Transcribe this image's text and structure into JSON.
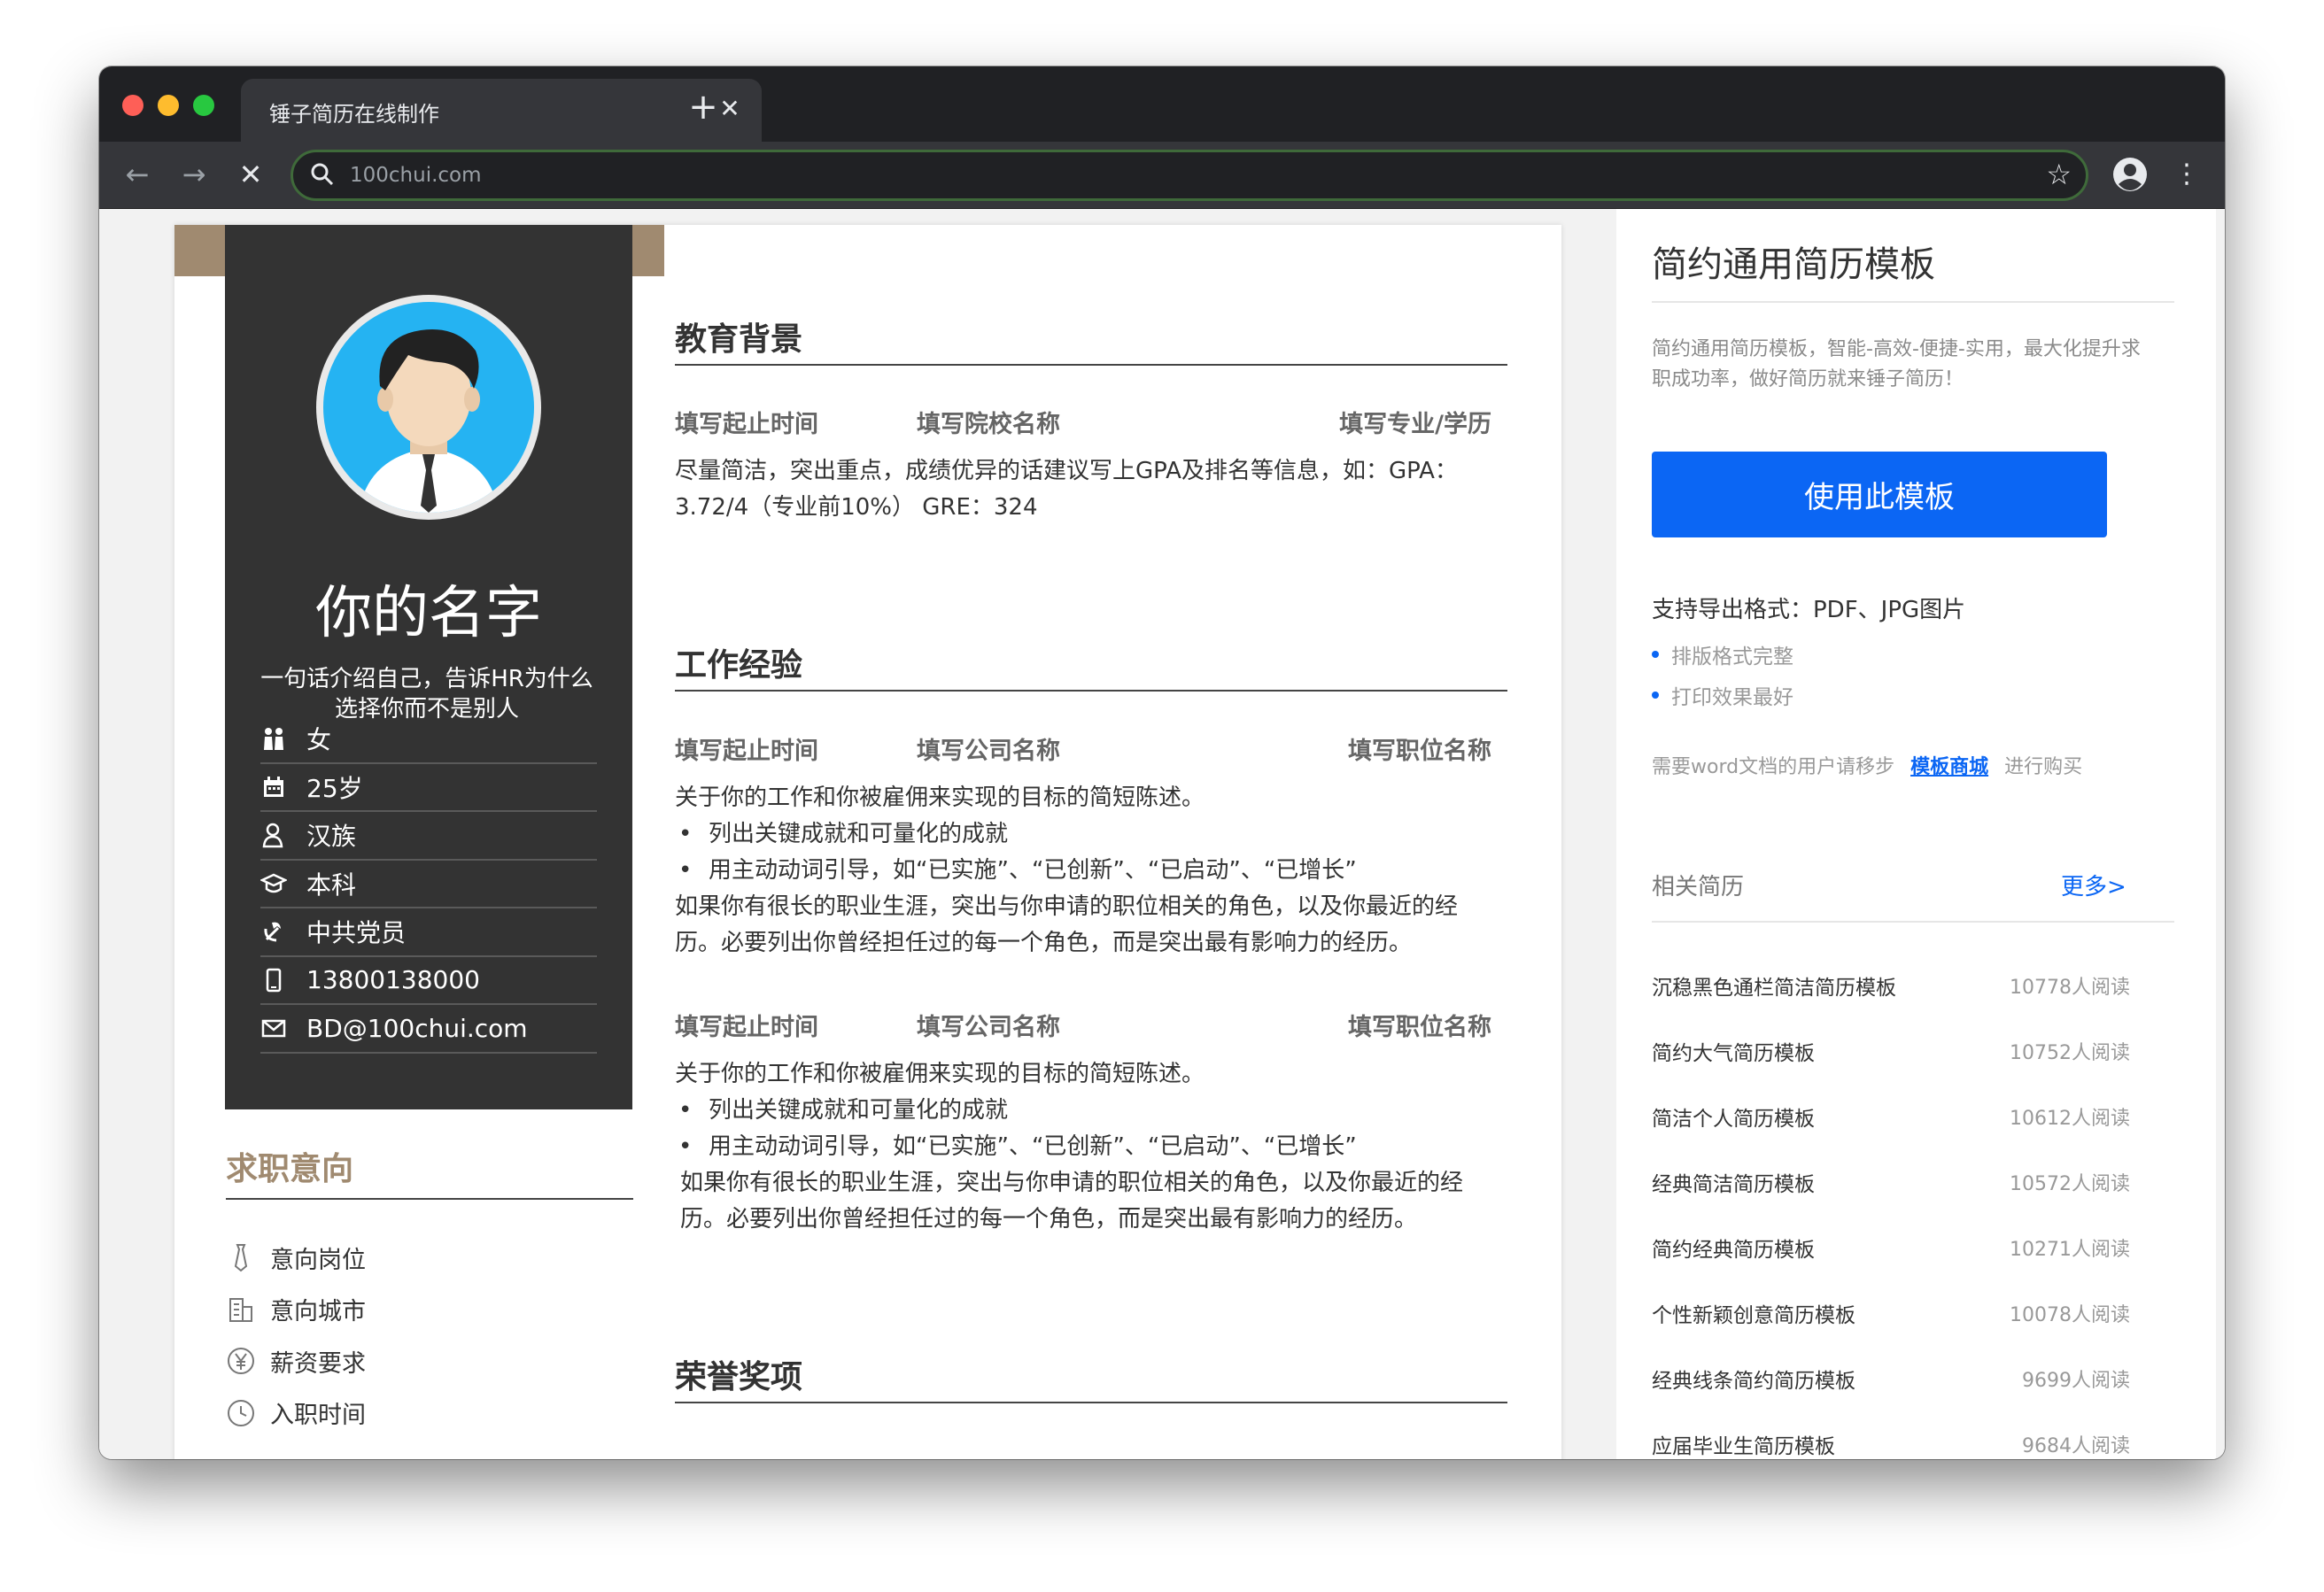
{
  "browser": {
    "tab_title": "锤子简历在线制作",
    "url": "100chui.com",
    "accent_color": "#3f6a3a"
  },
  "resume": {
    "name": "你的名字",
    "intro": "一句话介绍自己，告诉HR为什么选择你而不是别人",
    "info": [
      {
        "icon": "gender-icon",
        "text": "女"
      },
      {
        "icon": "calendar-icon",
        "text": "25岁"
      },
      {
        "icon": "person-icon",
        "text": "汉族"
      },
      {
        "icon": "graduation-cap-icon",
        "text": "本科"
      },
      {
        "icon": "party-icon",
        "text": "中共党员"
      },
      {
        "icon": "phone-icon",
        "text": "13800138000"
      },
      {
        "icon": "mail-icon",
        "text": "BD@100chui.com"
      }
    ],
    "intent": {
      "title": "求职意向",
      "items": [
        {
          "icon": "tie-icon",
          "text": "意向岗位"
        },
        {
          "icon": "building-icon",
          "text": "意向城市"
        },
        {
          "icon": "yen-icon",
          "text": "薪资要求"
        },
        {
          "icon": "clock-icon",
          "text": "入职时间"
        }
      ]
    },
    "education": {
      "title": "教育背景",
      "row": [
        "填写起止时间",
        "填写院校名称",
        "填写专业/学历"
      ],
      "desc": "尽量简洁，突出重点，成绩优异的话建议写上GPA及排名等信息，如：GPA：3.72/4（专业前10%） GRE：324"
    },
    "work": {
      "title": "工作经验",
      "entries": [
        {
          "row": [
            "填写起止时间",
            "填写公司名称",
            "填写职位名称"
          ],
          "lines": [
            "关于你的工作和你被雇佣来实现的目标的简短陈述。",
            "列出关键成就和可量化的成就",
            "用主动动词引导，如“已实施”、“已创新”、“已启动”、“已增长”",
            "如果你有很长的职业生涯，突出与你申请的职位相关的角色，以及你最近的经历。必要列出你曾经担任过的每一个角色，而是突出最有影响力的经历。"
          ]
        },
        {
          "row": [
            "填写起止时间",
            "填写公司名称",
            "填写职位名称"
          ],
          "lines": [
            "关于你的工作和你被雇佣来实现的目标的简短陈述。",
            "列出关键成就和可量化的成就",
            "用主动动词引导，如“已实施”、“已创新”、“已启动”、“已增长”",
            "如果你有很长的职业生涯，突出与你申请的职位相关的角色，以及你最近的经历。必要列出你曾经担任过的每一个角色，而是突出最有影响力的经历。"
          ]
        }
      ]
    },
    "honors": {
      "title": "荣誉奖项"
    }
  },
  "panel": {
    "title": "简约通用简历模板",
    "desc": "简约通用简历模板，智能-高效-便捷-实用，最大化提升求职成功率，做好简历就来锤子简历！",
    "use_button": "使用此模板",
    "formats": "支持导出格式：PDF、JPG图片",
    "features": [
      "排版格式完整",
      "打印效果最好"
    ],
    "word_prefix": "需要word文档的用户请移步",
    "word_link": "模板商城",
    "word_suffix": "进行购买",
    "related_title": "相关简历",
    "more": "更多>",
    "related": [
      {
        "title": "沉稳黑色通栏简洁简历模板",
        "reads": "10778人阅读"
      },
      {
        "title": "简约大气简历模板",
        "reads": "10752人阅读"
      },
      {
        "title": "简洁个人简历模板",
        "reads": "10612人阅读"
      },
      {
        "title": "经典简洁简历模板",
        "reads": "10572人阅读"
      },
      {
        "title": "简约经典简历模板",
        "reads": "10271人阅读"
      },
      {
        "title": "个性新颖创意简历模板",
        "reads": "10078人阅读"
      },
      {
        "title": "经典线条简约简历模板",
        "reads": "9699人阅读"
      },
      {
        "title": "应届毕业生简历模板",
        "reads": "9684人阅读"
      }
    ]
  },
  "colors": {
    "sidebar_dark": "#333333",
    "tan": "#a08a70",
    "primary_blue": "#0b66f4",
    "avatar_blue": "#25b3f2"
  }
}
